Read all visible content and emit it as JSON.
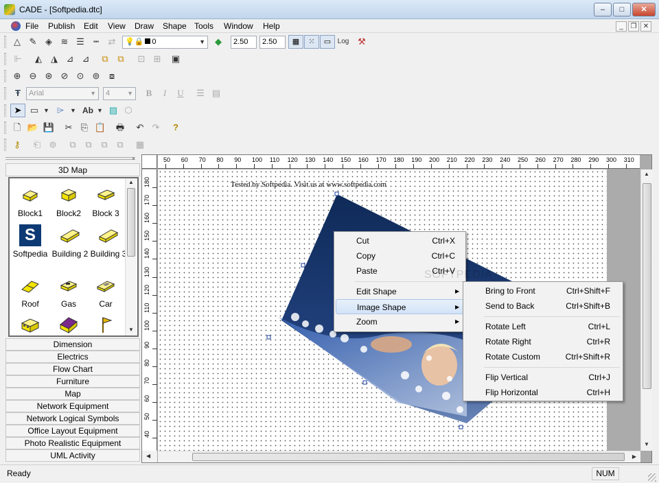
{
  "window": {
    "title": "CADE - [Softpedia.dtc]",
    "min": "–",
    "max": "□",
    "close": "✕"
  },
  "menubar": {
    "items": [
      "File",
      "Publish",
      "Edit",
      "View",
      "Draw",
      "Shape",
      "Tools",
      "Window",
      "Help"
    ]
  },
  "toolbar": {
    "layer_value": "0",
    "width_value1": "2.50",
    "width_value2": "2.50",
    "font_name": "Arial",
    "font_size": "4",
    "bold": "B",
    "italic": "I",
    "underline": "U",
    "text_tool": "Ab"
  },
  "left_panel": {
    "header": "3D Map",
    "shapes": [
      {
        "label": "Block1",
        "icon": "block-icon"
      },
      {
        "label": "Block2",
        "icon": "block-icon"
      },
      {
        "label": "Block 3",
        "icon": "block-icon"
      },
      {
        "label": "Softpedia",
        "icon": "softpedia-logo-icon"
      },
      {
        "label": "Building 2",
        "icon": "building-icon"
      },
      {
        "label": "Building 3",
        "icon": "building-icon"
      },
      {
        "label": "Roof",
        "icon": "roof-icon"
      },
      {
        "label": "Gas",
        "icon": "gas-icon"
      },
      {
        "label": "Car",
        "icon": "car-icon"
      },
      {
        "label": "",
        "icon": "bus-icon"
      },
      {
        "label": "",
        "icon": "house-icon"
      },
      {
        "label": "",
        "icon": "flag-icon"
      }
    ],
    "softpedia_letter": "S",
    "categories": [
      "Dimension",
      "Electrics",
      "Flow Chart",
      "Furniture",
      "Map",
      "Network Equipment",
      "Network Logical Symbols",
      "Office Layout Equipment",
      "Photo Realistic Equipment",
      "UML Activity"
    ]
  },
  "ruler": {
    "top": [
      "50",
      "60",
      "70",
      "80",
      "90",
      "100",
      "110",
      "120",
      "130",
      "140",
      "150",
      "160",
      "170",
      "180",
      "190",
      "200",
      "210",
      "220",
      "230",
      "240",
      "250",
      "260",
      "270",
      "280",
      "290",
      "300",
      "310"
    ],
    "left": [
      "180",
      "170",
      "160",
      "150",
      "140",
      "130",
      "120",
      "110",
      "100",
      "90",
      "80",
      "70",
      "60",
      "50",
      "40"
    ]
  },
  "canvas": {
    "caption": "Tested by Softpedia. Visit us at www.softpedia.com",
    "watermark": "SOFTPEDIA"
  },
  "context_menu": {
    "items": [
      {
        "label": "Cut",
        "shortcut": "Ctrl+X"
      },
      {
        "label": "Copy",
        "shortcut": "Ctrl+C"
      },
      {
        "label": "Paste",
        "shortcut": "Ctrl+V"
      },
      {
        "label": "Edit Shape",
        "shortcut": "",
        "submenu": true
      },
      {
        "label": "Image Shape",
        "shortcut": "",
        "submenu": true
      },
      {
        "label": "Zoom",
        "shortcut": "",
        "submenu": true
      }
    ]
  },
  "submenu": {
    "items": [
      {
        "label": "Bring to Front",
        "shortcut": "Ctrl+Shift+F"
      },
      {
        "label": "Send to Back",
        "shortcut": "Ctrl+Shift+B"
      },
      {
        "label": "Rotate Left",
        "shortcut": "Ctrl+L"
      },
      {
        "label": "Rotate Right",
        "shortcut": "Ctrl+R"
      },
      {
        "label": "Rotate Custom",
        "shortcut": "Ctrl+Shift+R"
      },
      {
        "label": "Flip Vertical",
        "shortcut": "Ctrl+J"
      },
      {
        "label": "Flip Horizontal",
        "shortcut": "Ctrl+H"
      }
    ]
  },
  "statusbar": {
    "left": "Ready",
    "right": "NUM"
  },
  "colors": {
    "accent": "#2a61b3",
    "shape_yellow": "#f3e400",
    "image_dark": "#0f2a58"
  }
}
